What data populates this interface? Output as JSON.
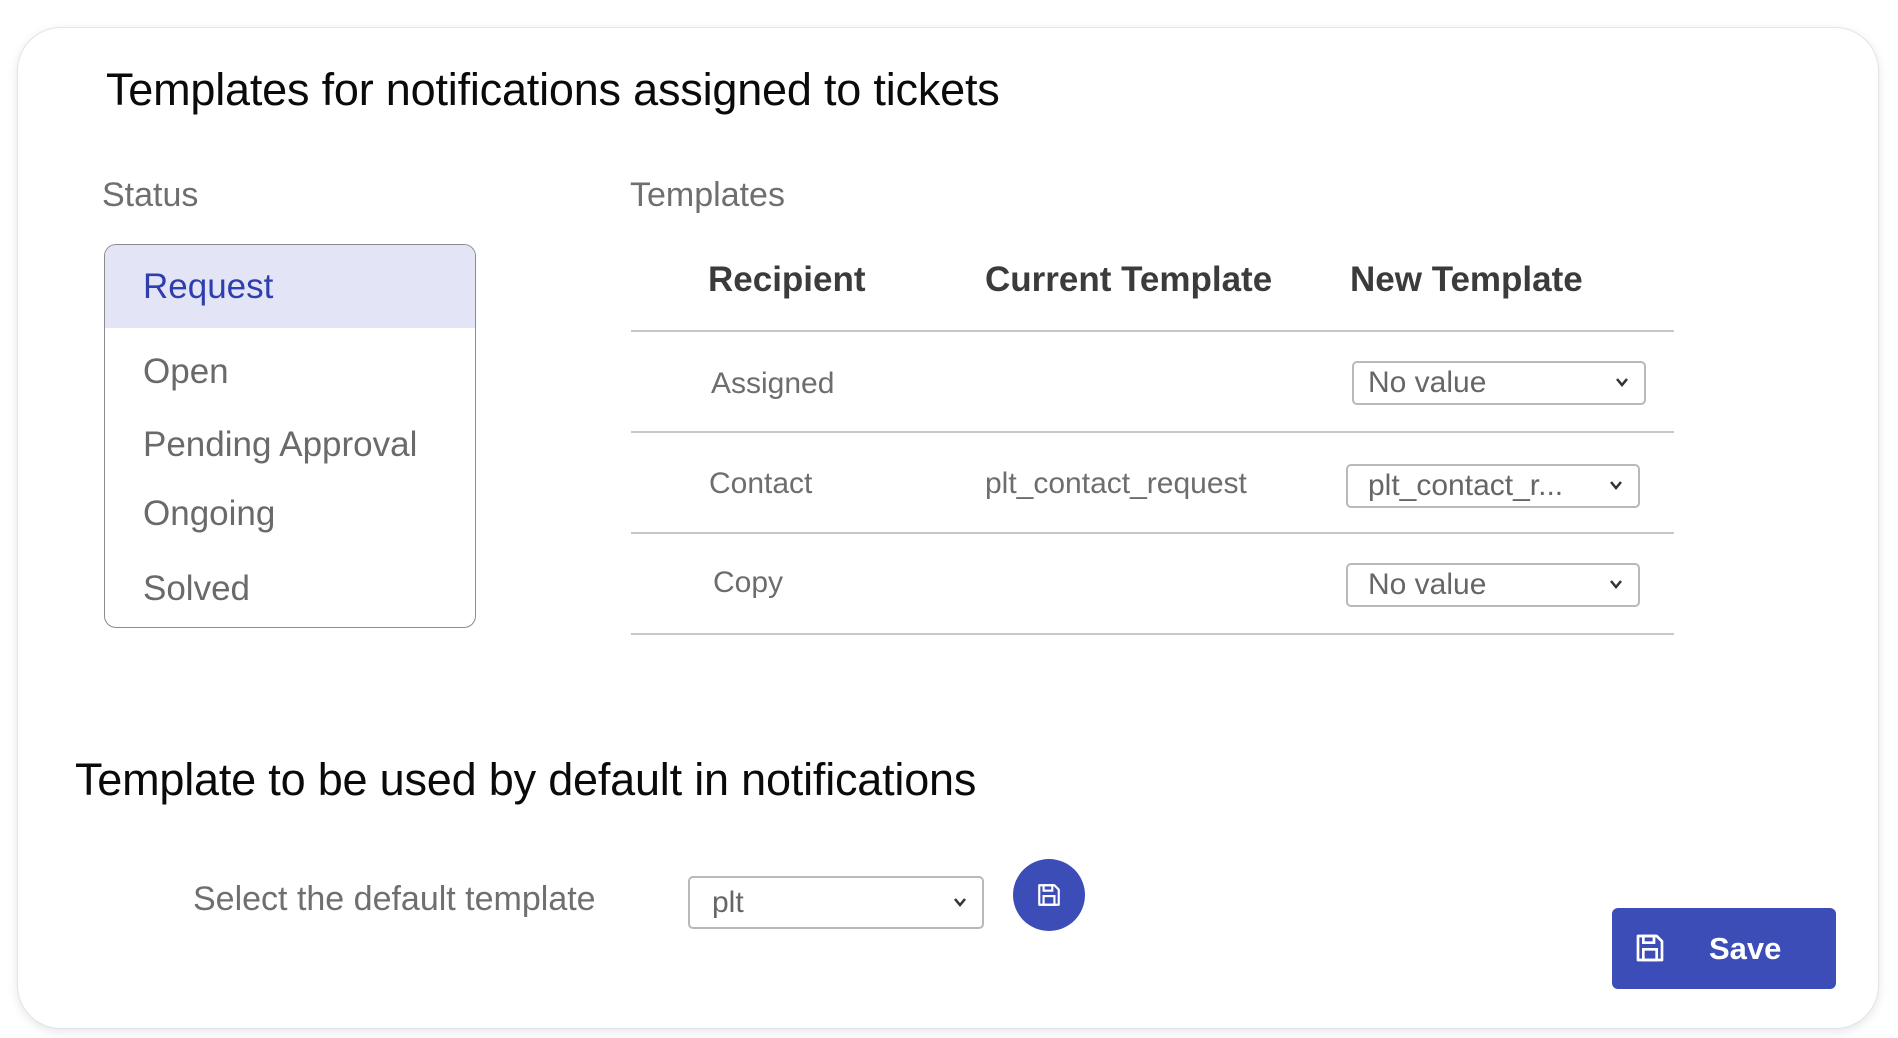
{
  "section_notifications": {
    "title": "Templates for notifications assigned to tickets",
    "status_label": "Status",
    "templates_label": "Templates"
  },
  "status_list": {
    "items": [
      "Request",
      "Open",
      "Pending Approval",
      "Ongoing",
      "Solved"
    ],
    "selected": "Request"
  },
  "templates_table": {
    "headers": {
      "recipient": "Recipient",
      "current": "Current Template",
      "new": "New Template"
    },
    "rows": [
      {
        "recipient": "Assigned",
        "current": "",
        "new": "No value"
      },
      {
        "recipient": "Contact",
        "current": "plt_contact_request",
        "new": "plt_contact_r..."
      },
      {
        "recipient": "Copy",
        "current": "",
        "new": "No value"
      }
    ]
  },
  "section_default": {
    "title": "Template to be used by default in notifications",
    "select_label": "Select the default template",
    "select_value": "plt"
  },
  "buttons": {
    "save_label": "Save"
  },
  "icons": {
    "save_default": "floppy-disk-icon",
    "save": "floppy-disk-icon",
    "dropdown": "chevron-down-icon"
  },
  "colors": {
    "accent": "#3d4db7",
    "selected_bg": "#e3e5f7",
    "selected_text": "#2e3fad"
  }
}
